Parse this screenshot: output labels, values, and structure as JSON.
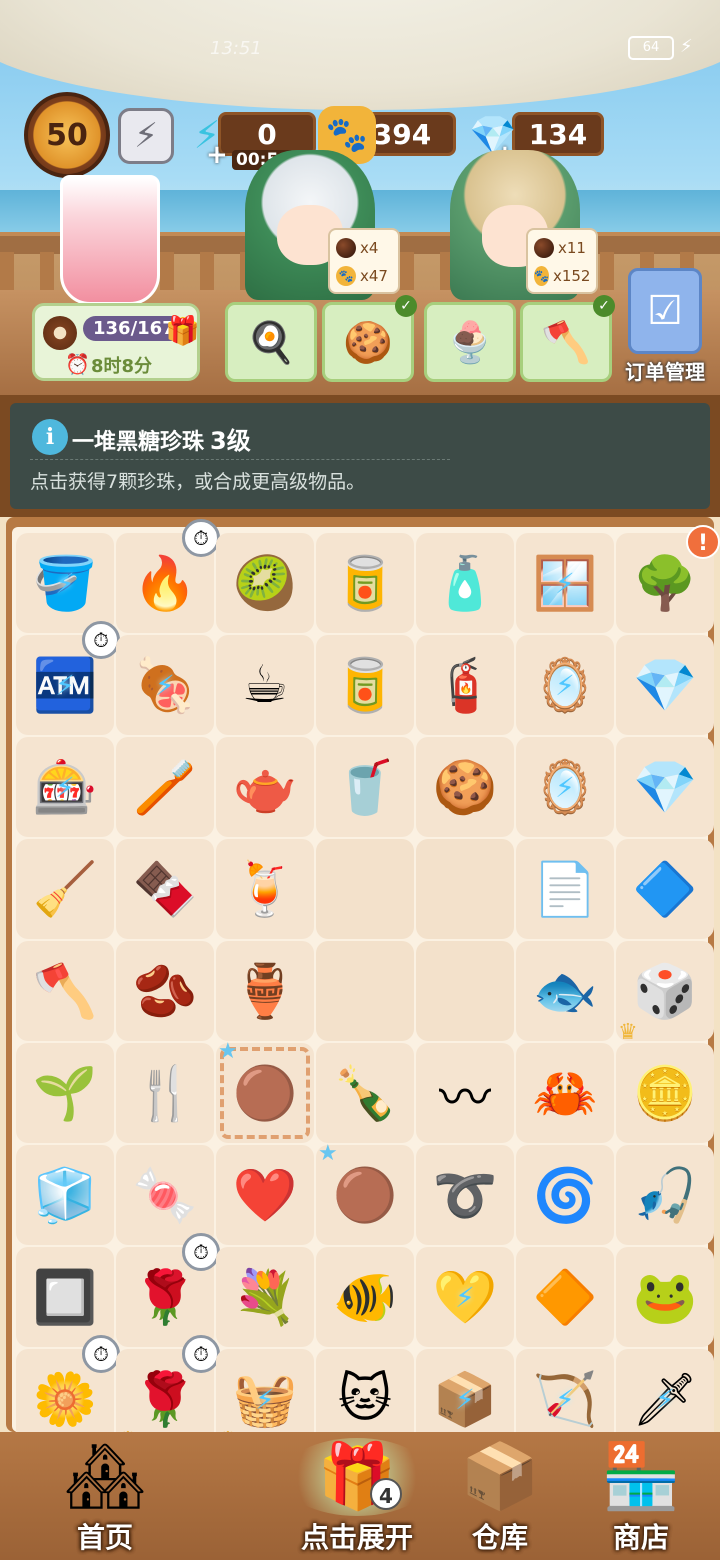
{
  "status": {
    "time": "13:51",
    "battery": "64"
  },
  "hud": {
    "level": "50",
    "energy": "0",
    "energy_timer": "00:58",
    "paw_coins": "394",
    "diamonds": "134"
  },
  "customers": [
    {
      "pearl_count": "x4",
      "paw_reward": "x47"
    },
    {
      "pearl_count": "x11",
      "paw_reward": "x152"
    }
  ],
  "stall": {
    "progress": "136/167",
    "timer": "8时8分"
  },
  "order_manage_label": "订单管理",
  "info": {
    "title": "一堆黑糖珍珠",
    "level": "3级",
    "desc": "点击获得7颗珍珠，或合成更高级物品。"
  },
  "board": {
    "rows": [
      [
        {
          "icon": "ice-bucket",
          "glyph": "🪣",
          "bolt": true
        },
        {
          "icon": "grill",
          "glyph": "🔥",
          "timer": true
        },
        {
          "icon": "fruit-plate",
          "glyph": "🥝"
        },
        {
          "icon": "paint-cans",
          "glyph": "🥫"
        },
        {
          "icon": "detergent-bottle",
          "glyph": "🧴"
        },
        {
          "icon": "display-stand",
          "glyph": "🪟",
          "bolt": true
        },
        {
          "icon": "money-tree",
          "glyph": "🌳",
          "alert": true
        }
      ],
      [
        {
          "icon": "vending-machine",
          "glyph": "🏧",
          "bolt": true,
          "timer": true
        },
        {
          "icon": "big-grill",
          "glyph": "🍖",
          "bolt": true
        },
        {
          "icon": "coffee-cup",
          "glyph": "☕"
        },
        {
          "icon": "tin-can",
          "glyph": "🥫"
        },
        {
          "icon": "spray-bottle",
          "glyph": "🧯"
        },
        {
          "icon": "stand-frame",
          "glyph": "🪞",
          "bolt": true
        },
        {
          "icon": "diamond-pile",
          "glyph": "💎"
        }
      ],
      [
        {
          "icon": "claw-machine",
          "glyph": "🎰",
          "bolt": true
        },
        {
          "icon": "toothpaste",
          "glyph": "🪥"
        },
        {
          "icon": "teapot",
          "glyph": "🫖"
        },
        {
          "icon": "soda-can",
          "glyph": "🥤"
        },
        {
          "icon": "paw-cookie",
          "glyph": "🍪"
        },
        {
          "icon": "mirror-stand",
          "glyph": "🪞",
          "bolt": true
        },
        {
          "icon": "diamond-pair",
          "glyph": "💎"
        }
      ],
      [
        {
          "icon": "rake",
          "glyph": "🧹"
        },
        {
          "icon": "chocolate",
          "glyph": "🍫"
        },
        {
          "icon": "watermelon-juice",
          "glyph": "🍹"
        },
        {
          "icon": "empty",
          "glyph": ""
        },
        {
          "icon": "empty",
          "glyph": ""
        },
        {
          "icon": "paper",
          "glyph": "📄"
        },
        {
          "icon": "diamond",
          "glyph": "🔷"
        }
      ],
      [
        {
          "icon": "axe",
          "glyph": "🪓"
        },
        {
          "icon": "sprouting-bean",
          "glyph": "🫘"
        },
        {
          "icon": "vase",
          "glyph": "🏺"
        },
        {
          "icon": "empty",
          "glyph": ""
        },
        {
          "icon": "empty",
          "glyph": ""
        },
        {
          "icon": "fish",
          "glyph": "🐟"
        },
        {
          "icon": "mystery-box",
          "glyph": "🎲",
          "crown": true
        }
      ],
      [
        {
          "icon": "seedling-pot",
          "glyph": "🌱"
        },
        {
          "icon": "garden-fork",
          "glyph": "🍴"
        },
        {
          "icon": "brown-sugar-pearls",
          "glyph": "🟤",
          "selected": true,
          "star": true
        },
        {
          "icon": "bottle-seaweed",
          "glyph": "🍾"
        },
        {
          "icon": "string",
          "glyph": "〰"
        },
        {
          "icon": "crab",
          "glyph": "🦀"
        },
        {
          "icon": "coin-disc",
          "glyph": "🪙"
        }
      ],
      [
        {
          "icon": "glass-box",
          "glyph": "🧊"
        },
        {
          "icon": "candy",
          "glyph": "🍬"
        },
        {
          "icon": "petal-heart",
          "glyph": "❤️"
        },
        {
          "icon": "single-pearl",
          "glyph": "🟤",
          "star": true
        },
        {
          "icon": "rope",
          "glyph": "➰"
        },
        {
          "icon": "rope-coil",
          "glyph": "🌀"
        },
        {
          "icon": "fishing-float",
          "glyph": "🎣"
        }
      ],
      [
        {
          "icon": "glass-trays",
          "glyph": "🔲"
        },
        {
          "icon": "rose-pot",
          "glyph": "🌹",
          "timer": true
        },
        {
          "icon": "rose-heart",
          "glyph": "💐"
        },
        {
          "icon": "purple-fish",
          "glyph": "🐠"
        },
        {
          "icon": "heart-frame",
          "glyph": "💛",
          "bolt": true
        },
        {
          "icon": "tangram",
          "glyph": "🔶"
        },
        {
          "icon": "frog",
          "glyph": "🐸"
        }
      ],
      [
        {
          "icon": "flower-vase",
          "glyph": "🌼",
          "timer": true
        },
        {
          "icon": "rose-bouquet",
          "glyph": "🌹",
          "timer": true,
          "crown": true
        },
        {
          "icon": "gift-basket",
          "glyph": "🧺",
          "bolt": true,
          "crown": true
        },
        {
          "icon": "cat-keychain",
          "glyph": "🐱"
        },
        {
          "icon": "gold-box",
          "glyph": "📦",
          "bolt": true
        },
        {
          "icon": "bow",
          "glyph": "🏹",
          "bolt": true
        },
        {
          "icon": "bow-knife",
          "glyph": "🗡",
          "bolt": true
        }
      ]
    ]
  },
  "nav": {
    "home": "首页",
    "expand": "点击展开",
    "expand_count": "4",
    "storage": "仓库",
    "shop": "商店"
  }
}
